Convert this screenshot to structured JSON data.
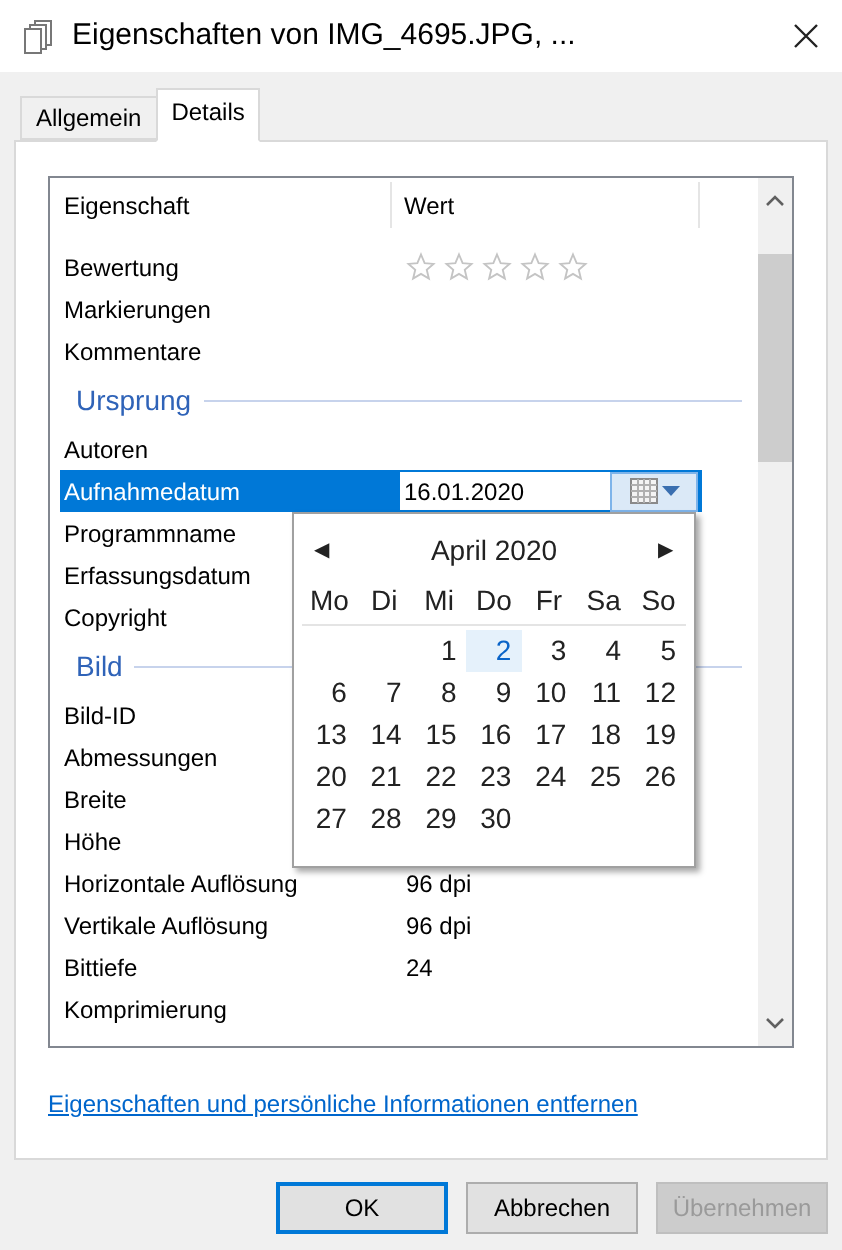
{
  "window": {
    "title": "Eigenschaften von IMG_4695.JPG, ..."
  },
  "tabs": [
    {
      "label": "Allgemein",
      "selected": false
    },
    {
      "label": "Details",
      "selected": true
    }
  ],
  "list": {
    "columns": [
      "Eigenschaft",
      "Wert"
    ],
    "rows": [
      {
        "kind": "rating",
        "name": "Bewertung",
        "stars": 0,
        "selected": false
      },
      {
        "kind": "property",
        "name": "Markierungen",
        "selected": false
      },
      {
        "kind": "property",
        "name": "Kommentare",
        "selected": false
      },
      {
        "kind": "group",
        "name": "Ursprung"
      },
      {
        "kind": "property",
        "name": "Autoren",
        "selected": false
      },
      {
        "kind": "date",
        "name": "Aufnahmedatum",
        "value": "16.01.2020",
        "selected": true
      },
      {
        "kind": "property",
        "name": "Programmname",
        "selected": false
      },
      {
        "kind": "property",
        "name": "Erfassungsdatum",
        "selected": false
      },
      {
        "kind": "property",
        "name": "Copyright",
        "selected": false
      },
      {
        "kind": "group",
        "name": "Bild"
      },
      {
        "kind": "property",
        "name": "Bild-ID",
        "selected": false
      },
      {
        "kind": "property",
        "name": "Abmessungen",
        "selected": false
      },
      {
        "kind": "property",
        "name": "Breite",
        "selected": false
      },
      {
        "kind": "property",
        "name": "Höhe",
        "selected": false
      },
      {
        "kind": "property",
        "name": "Horizontale Auflösung",
        "value": "96 dpi",
        "selected": false
      },
      {
        "kind": "property",
        "name": "Vertikale Auflösung",
        "value": "96 dpi",
        "selected": false
      },
      {
        "kind": "property",
        "name": "Bittiefe",
        "value": "24",
        "selected": false
      },
      {
        "kind": "property",
        "name": "Komprimierung",
        "selected": false
      }
    ]
  },
  "calendar": {
    "prev": "◀",
    "next": "▶",
    "month": "April 2020",
    "weekdays": [
      "Mo",
      "Di",
      "Mi",
      "Do",
      "Fr",
      "Sa",
      "So"
    ],
    "weeks": [
      {
        "kind": "first",
        "days": [
          {
            "label": "1",
            "selected": false
          },
          {
            "label": "2",
            "selected": true
          },
          {
            "label": "3",
            "selected": false
          },
          {
            "label": "4",
            "selected": false
          },
          {
            "label": "5",
            "selected": false
          }
        ]
      },
      {
        "kind": "full",
        "days": [
          {
            "label": "6",
            "selected": false
          },
          {
            "label": "7",
            "selected": false
          },
          {
            "label": "8",
            "selected": false
          },
          {
            "label": "9",
            "selected": false
          },
          {
            "label": "10",
            "selected": false
          },
          {
            "label": "11",
            "selected": false
          },
          {
            "label": "12",
            "selected": false
          }
        ]
      },
      {
        "kind": "full",
        "days": [
          {
            "label": "13",
            "selected": false
          },
          {
            "label": "14",
            "selected": false
          },
          {
            "label": "15",
            "selected": false
          },
          {
            "label": "16",
            "selected": false
          },
          {
            "label": "17",
            "selected": false
          },
          {
            "label": "18",
            "selected": false
          },
          {
            "label": "19",
            "selected": false
          }
        ]
      },
      {
        "kind": "full",
        "days": [
          {
            "label": "20",
            "selected": false
          },
          {
            "label": "21",
            "selected": false
          },
          {
            "label": "22",
            "selected": false
          },
          {
            "label": "23",
            "selected": false
          },
          {
            "label": "24",
            "selected": false
          },
          {
            "label": "25",
            "selected": false
          },
          {
            "label": "26",
            "selected": false
          }
        ]
      },
      {
        "kind": "last",
        "days": [
          {
            "label": "27",
            "selected": false
          },
          {
            "label": "28",
            "selected": false
          },
          {
            "label": "29",
            "selected": false
          },
          {
            "label": "30",
            "selected": false
          }
        ]
      }
    ]
  },
  "link": "Eigenschaften und persönliche Informationen entfernen",
  "buttons": [
    {
      "label": "OK",
      "default": true,
      "disabled": false
    },
    {
      "label": "Abbrechen",
      "default": false,
      "disabled": false
    },
    {
      "label": "Übernehmen",
      "default": false,
      "disabled": true
    }
  ]
}
